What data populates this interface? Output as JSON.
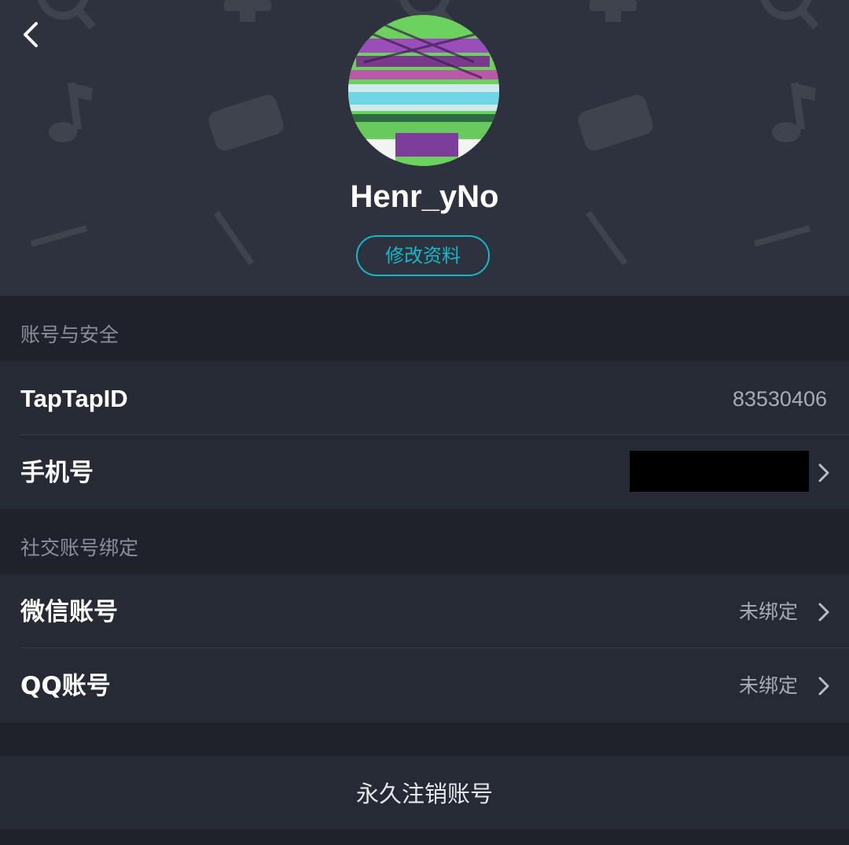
{
  "profile": {
    "username": "Henr_yNo",
    "edit_button_label": "修改资料"
  },
  "account_security": {
    "section_title": "账号与安全",
    "taptap_id_label": "TapTapID",
    "taptap_id_value": "83530406",
    "phone_label": "手机号"
  },
  "social_binding": {
    "section_title": "社交账号绑定",
    "wechat_label": "微信账号",
    "wechat_status": "未绑定",
    "qq_label": "QQ账号",
    "qq_status": "未绑定"
  },
  "delete_account_label": "永久注销账号",
  "colors": {
    "header_bg": "#2d323e",
    "page_bg": "#1f222b",
    "row_bg": "#262a35",
    "accent": "#14b9c8",
    "text_primary": "#ffffff",
    "text_secondary": "#a7acb4"
  },
  "icons": {
    "back": "chevron-left-icon",
    "row_arrow": "chevron-right-icon",
    "header_pattern": [
      "search-icon",
      "trophy-icon",
      "music-note-icon",
      "gamepad-icon",
      "arrow-icon"
    ]
  }
}
